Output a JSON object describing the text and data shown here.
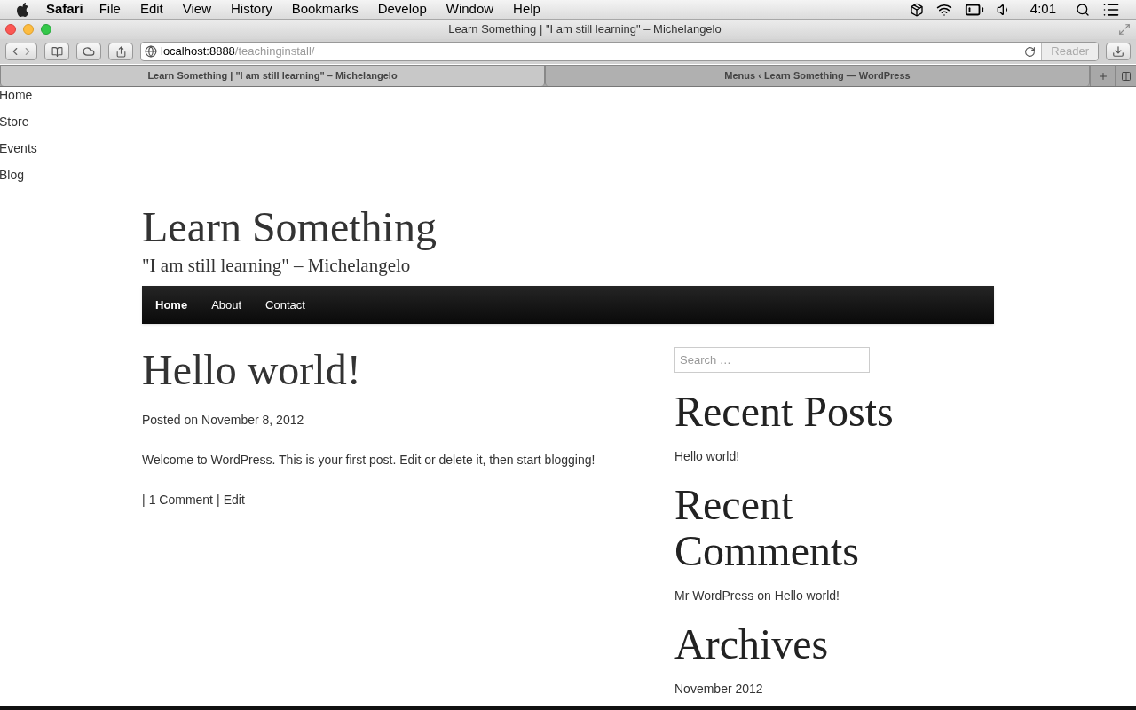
{
  "menubar": {
    "app": "Safari",
    "items": [
      "File",
      "Edit",
      "View",
      "History",
      "Bookmarks",
      "Develop",
      "Window",
      "Help"
    ],
    "clock": "4:01"
  },
  "window": {
    "title": "Learn Something | \"I am still learning\" – Michelangelo"
  },
  "address": {
    "host": "localhost:8888",
    "path": "/teachinginstall/"
  },
  "reader_button": "Reader",
  "tabs": [
    {
      "label": "Learn Something | \"I am still learning\" – Michelangelo",
      "selected": true
    },
    {
      "label": "Menus ‹ Learn Something — WordPress",
      "selected": false
    }
  ],
  "page": {
    "top_menu": [
      "Home",
      "Store",
      "Events",
      "Blog"
    ],
    "site_title": "Learn Something",
    "tagline": "\"I am still learning\" – Michelangelo",
    "nav": [
      {
        "label": "Home",
        "selected": true
      },
      {
        "label": "About",
        "selected": false
      },
      {
        "label": "Contact",
        "selected": false
      }
    ],
    "post": {
      "title": "Hello world!",
      "meta_prefix": "Posted on",
      "date": "November 8, 2012",
      "body": "Welcome to WordPress. This is your first post. Edit or delete it, then start blogging!",
      "separator": "|",
      "comments_link": "1 Comment",
      "edit_link": "Edit"
    },
    "search": {
      "placeholder": "Search …"
    },
    "widgets": [
      {
        "title": "Recent Posts",
        "items": [
          {
            "kind": "link",
            "text": "Hello world!"
          }
        ]
      },
      {
        "title": "Recent Comments",
        "items": [
          {
            "kind": "comment",
            "author": "Mr WordPress",
            "joiner": "on",
            "post": "Hello world!"
          }
        ]
      },
      {
        "title": "Archives",
        "items": [
          {
            "kind": "link",
            "text": "November 2012"
          }
        ]
      }
    ]
  }
}
